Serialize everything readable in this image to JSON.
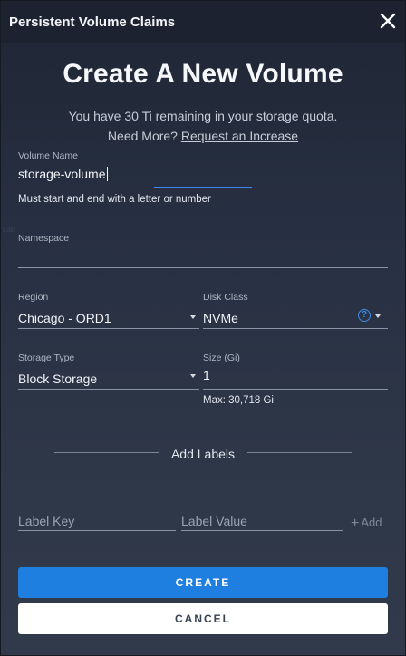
{
  "dialog": {
    "title": "Persistent Volume Claims",
    "heading": "Create A New Volume",
    "quota_text": "You have 30 Ti remaining in your storage quota.",
    "need_more": "Need More?",
    "request_link": "Request an Increase"
  },
  "form": {
    "volume_name": {
      "label": "Volume Name",
      "value": "storage-volume",
      "helper": "Must start and end with a letter or number"
    },
    "namespace": {
      "label": "Namespace",
      "value": ""
    },
    "region": {
      "label": "Region",
      "value": "Chicago - ORD1"
    },
    "disk_class": {
      "label": "Disk Class",
      "value": "NVMe"
    },
    "storage_type": {
      "label": "Storage Type",
      "value": "Block Storage"
    },
    "size": {
      "label": "Size (Gi)",
      "value": "1",
      "helper": "Max: 30,718 Gi"
    }
  },
  "labels": {
    "section_title": "Add Labels",
    "key_placeholder": "Label Key",
    "value_placeholder": "Label Value",
    "add_label": "Add"
  },
  "buttons": {
    "create": "CREATE",
    "cancel": "CANCEL"
  },
  "icons": {
    "close": "close-icon",
    "help": "help-circle-icon",
    "dropdown": "chevron-down-icon",
    "add": "plus-icon"
  },
  "colors": {
    "accent": "#1f7fe0",
    "focus": "#3d8be8",
    "background": "#2b3342"
  }
}
